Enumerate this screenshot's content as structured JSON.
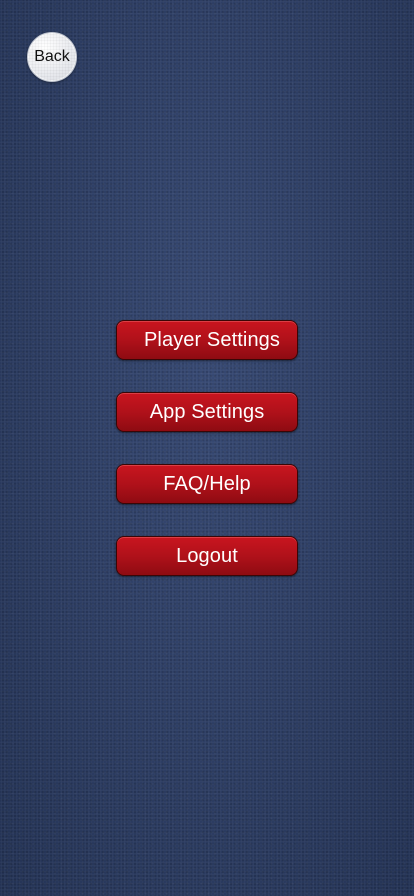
{
  "header": {
    "back_label": "Back"
  },
  "menu": {
    "items": [
      {
        "id": "player-settings",
        "label": "Player Settings"
      },
      {
        "id": "app-settings",
        "label": "App Settings"
      },
      {
        "id": "faq-help",
        "label": "FAQ/Help"
      },
      {
        "id": "logout",
        "label": "Logout"
      }
    ]
  },
  "colors": {
    "background": "#2e4068",
    "button_red": "#b0111a",
    "button_text": "#ffffff",
    "back_button": "#f0f1f4"
  }
}
